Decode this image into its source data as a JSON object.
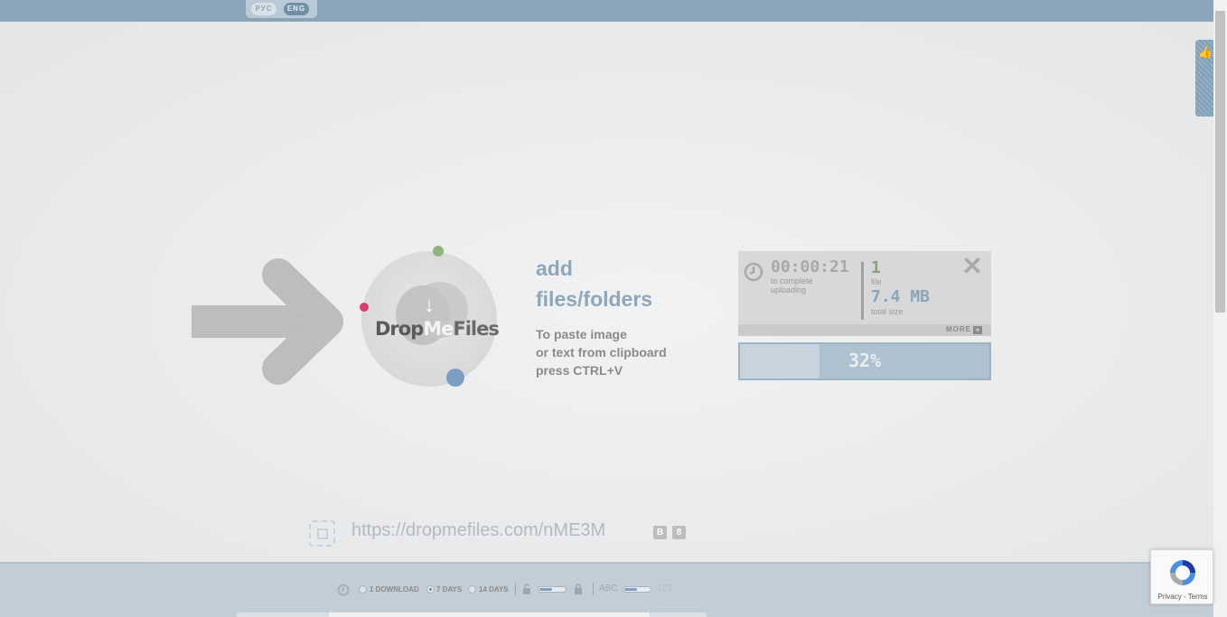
{
  "header": {
    "lang_ru": "РУС",
    "lang_en": "ENG"
  },
  "logo": {
    "drop": "Drop",
    "me": "Me",
    "files": "Files",
    "arrow_glyph": "↓"
  },
  "add": {
    "line1": "add",
    "line2": "files/folders"
  },
  "paste": {
    "line1": "To paste image",
    "line2": "or text from clipboard",
    "line3": "press CTRL+V"
  },
  "upload": {
    "timer": "00:00:21",
    "timer_label": "to complete uploading",
    "file_count": "1",
    "file_label": "file",
    "total_size": "7.4 MB",
    "size_label": "total size",
    "more_label": "MORE",
    "more_plus": "+",
    "close_glyph": "✕",
    "progress_text": "32%",
    "progress_fraction": 0.32
  },
  "share": {
    "url": "https://dropmefiles.com/nME3M",
    "vk": "B",
    "ok": "8"
  },
  "options": {
    "one_download": "1 DOWNLOAD",
    "seven_days": "7 DAYS",
    "fourteen_days": "14 DAYS",
    "abc": "ABC",
    "num": "123",
    "selected": "7 DAYS"
  },
  "recaptcha": {
    "links": "Privacy - Terms"
  },
  "colors": {
    "topbar": "#8aa5b8",
    "accent_blue": "#7b9fc2",
    "accent_green": "#8fb47e",
    "accent_pink": "#d63b72"
  }
}
